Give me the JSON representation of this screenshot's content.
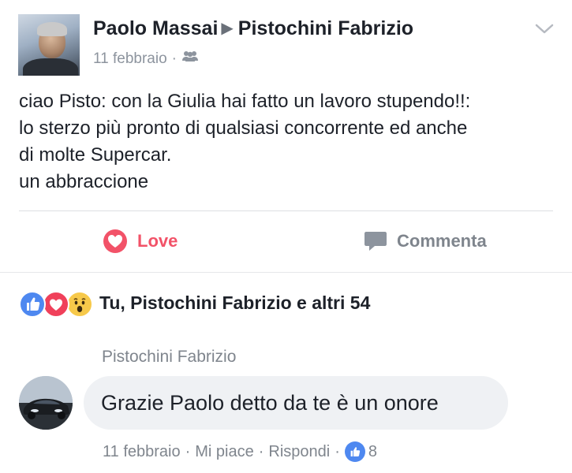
{
  "post": {
    "author": "Paolo Massai",
    "target": "Pistochini Fabrizio",
    "date": "11 febbraio",
    "audience_icon": "friends-icon",
    "menu_icon": "chevron-down-icon",
    "text_lines": [
      "ciao Pisto: con la Giulia hai fatto un lavoro stupendo!!:",
      "lo sterzo più pronto di qualsiasi concorrente ed anche",
      "di molte Supercar.",
      "un abbraccione"
    ]
  },
  "actions": {
    "love_label": "Love",
    "comment_label": "Commenta"
  },
  "reactions": {
    "icons": [
      "like-icon",
      "love-icon",
      "wow-icon"
    ],
    "summary": "Tu, Pistochini Fabrizio e altri 54"
  },
  "comment": {
    "author": "Pistochini Fabrizio",
    "text": "Grazie Paolo detto da te è un onore",
    "date": "11 febbraio",
    "like_label": "Mi piace",
    "reply_label": "Rispondi",
    "like_count": "8"
  },
  "colors": {
    "love": "#f25268",
    "like": "#4e88f0",
    "muted": "#7f858d"
  }
}
